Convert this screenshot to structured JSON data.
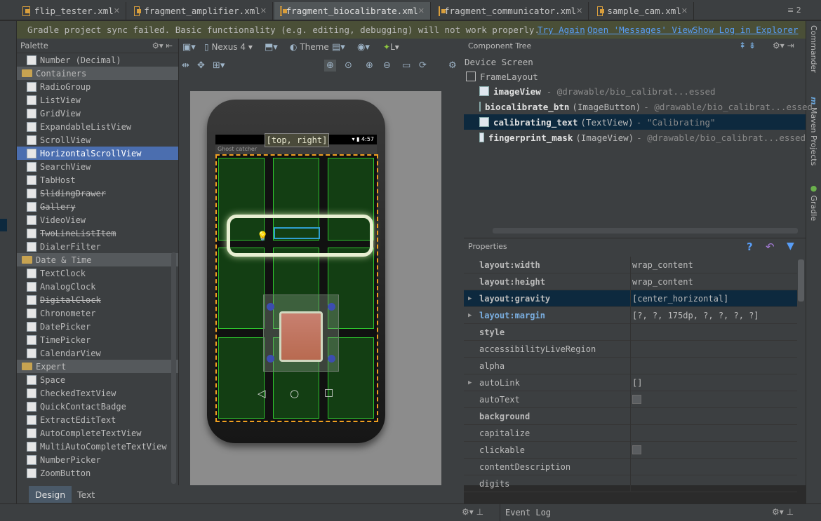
{
  "tabs": [
    {
      "label": "flip_tester.xml",
      "active": false
    },
    {
      "label": "fragment_amplifier.xml",
      "active": false
    },
    {
      "label": "fragment_biocalibrate.xml",
      "active": true
    },
    {
      "label": "fragment_communicator.xml",
      "active": false
    },
    {
      "label": "sample_cam.xml",
      "active": false
    }
  ],
  "tab_overflow": "≡ 2",
  "gradle": {
    "message": "Gradle project sync failed. Basic functionality (e.g. editing, debugging) will not work properly.",
    "try_again": "Try Again",
    "open_messages": "Open 'Messages' View",
    "show_log": "Show Log in Explorer"
  },
  "right_tool_windows": [
    "Commander",
    "Maven Projects",
    "Gradle"
  ],
  "palette": {
    "title": "Palette",
    "entries": [
      {
        "kind": "item",
        "label": "Number (Decimal)"
      },
      {
        "kind": "category",
        "label": "Containers"
      },
      {
        "kind": "item",
        "label": "RadioGroup"
      },
      {
        "kind": "item",
        "label": "ListView"
      },
      {
        "kind": "item",
        "label": "GridView"
      },
      {
        "kind": "item",
        "label": "ExpandableListView"
      },
      {
        "kind": "item",
        "label": "ScrollView"
      },
      {
        "kind": "item",
        "label": "HorizontalScrollView",
        "selected": true
      },
      {
        "kind": "item",
        "label": "SearchView"
      },
      {
        "kind": "item",
        "label": "TabHost"
      },
      {
        "kind": "item",
        "label": "SlidingDrawer",
        "deprecated": true
      },
      {
        "kind": "item",
        "label": "Gallery",
        "deprecated": true
      },
      {
        "kind": "item",
        "label": "VideoView"
      },
      {
        "kind": "item",
        "label": "TwoLineListItem",
        "deprecated": true
      },
      {
        "kind": "item",
        "label": "DialerFilter"
      },
      {
        "kind": "category",
        "label": "Date & Time"
      },
      {
        "kind": "item",
        "label": "TextClock"
      },
      {
        "kind": "item",
        "label": "AnalogClock"
      },
      {
        "kind": "item",
        "label": "DigitalClock",
        "deprecated": true
      },
      {
        "kind": "item",
        "label": "Chronometer"
      },
      {
        "kind": "item",
        "label": "DatePicker"
      },
      {
        "kind": "item",
        "label": "TimePicker"
      },
      {
        "kind": "item",
        "label": "CalendarView"
      },
      {
        "kind": "category",
        "label": "Expert"
      },
      {
        "kind": "item",
        "label": "Space"
      },
      {
        "kind": "item",
        "label": "CheckedTextView"
      },
      {
        "kind": "item",
        "label": "QuickContactBadge"
      },
      {
        "kind": "item",
        "label": "ExtractEditText"
      },
      {
        "kind": "item",
        "label": "AutoCompleteTextView"
      },
      {
        "kind": "item",
        "label": "MultiAutoCompleteTextView"
      },
      {
        "kind": "item",
        "label": "NumberPicker"
      },
      {
        "kind": "item",
        "label": "ZoomButton"
      }
    ]
  },
  "toolbar": {
    "device": "Nexus 4",
    "theme": "Theme",
    "api": "L"
  },
  "device": {
    "time": "4:57",
    "app_title": "Ghost catcher",
    "tooltip": "[top, right]"
  },
  "component_tree": {
    "title": "Component Tree",
    "root": "Device Screen",
    "layout": "FrameLayout",
    "nodes": [
      {
        "id": "imageView",
        "type": "",
        "value": "- @drawable/bio_calibrat...essed"
      },
      {
        "id": "biocalibrate_btn",
        "type": "(ImageButton)",
        "value": "- @drawable/bio_calibrat...essed"
      },
      {
        "id": "calibrating_text",
        "type": "(TextView)",
        "value": "- \"Calibrating\"",
        "selected": true
      },
      {
        "id": "fingerprint_mask",
        "type": "(ImageView)",
        "value": "- @drawable/bio_calibrat...essed"
      }
    ]
  },
  "properties": {
    "title": "Properties",
    "rows": [
      {
        "name": "layout:width",
        "value": "wrap_content",
        "bold": true
      },
      {
        "name": "layout:height",
        "value": "wrap_content",
        "bold": true
      },
      {
        "name": "layout:gravity",
        "value": "[center_horizontal]",
        "bold": true,
        "expandable": true,
        "selected": true
      },
      {
        "name": "layout:margin",
        "value": "[?, ?, 175dp, ?, ?, ?, ?]",
        "bold": true,
        "blue": true,
        "expandable": true
      },
      {
        "name": "style",
        "value": "",
        "bold": true
      },
      {
        "name": "accessibilityLiveRegion",
        "value": ""
      },
      {
        "name": "alpha",
        "value": ""
      },
      {
        "name": "autoLink",
        "value": "[]",
        "expandable": true
      },
      {
        "name": "autoText",
        "value": "",
        "checkbox": true
      },
      {
        "name": "background",
        "value": "",
        "bold": true
      },
      {
        "name": "capitalize",
        "value": ""
      },
      {
        "name": "clickable",
        "value": "",
        "checkbox": true
      },
      {
        "name": "contentDescription",
        "value": ""
      },
      {
        "name": "digits",
        "value": ""
      }
    ]
  },
  "bottom_tabs": [
    "Design",
    "Text"
  ],
  "status": {
    "event_log": "Event Log"
  }
}
